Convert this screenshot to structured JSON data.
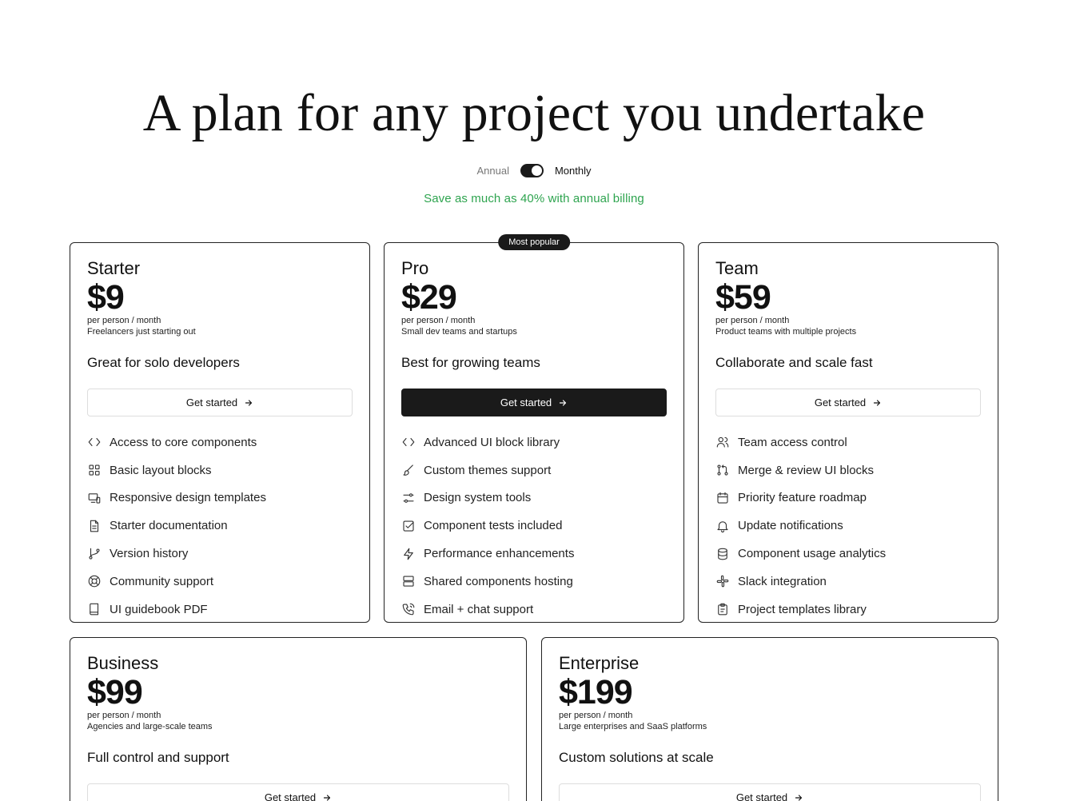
{
  "hero": {
    "title": "A plan for any project you undertake"
  },
  "billing": {
    "annual_label": "Annual",
    "monthly_label": "Monthly",
    "selected": "Monthly",
    "savings_text": "Save as much as 40% with annual billing",
    "savings_color": "#2ea44f"
  },
  "plans": [
    {
      "name": "Starter",
      "price": "$9",
      "period": "per person / month",
      "audience": "Freelancers just starting out",
      "tagline": "Great for solo developers",
      "cta": "Get started",
      "primary": false,
      "features": [
        {
          "icon": "code-icon",
          "label": "Access to core components"
        },
        {
          "icon": "grid-icon",
          "label": "Basic layout blocks"
        },
        {
          "icon": "devices-icon",
          "label": "Responsive design templates"
        },
        {
          "icon": "document-icon",
          "label": "Starter documentation"
        },
        {
          "icon": "git-branch-icon",
          "label": "Version history"
        },
        {
          "icon": "lifebuoy-icon",
          "label": "Community support"
        },
        {
          "icon": "book-icon",
          "label": "UI guidebook PDF"
        }
      ]
    },
    {
      "name": "Pro",
      "badge": "Most popular",
      "price": "$29",
      "period": "per person / month",
      "audience": "Small dev teams and startups",
      "tagline": "Best for growing teams",
      "cta": "Get started",
      "primary": true,
      "features": [
        {
          "icon": "code-icon",
          "label": "Advanced UI block library"
        },
        {
          "icon": "brush-icon",
          "label": "Custom themes support"
        },
        {
          "icon": "sliders-icon",
          "label": "Design system tools"
        },
        {
          "icon": "checkbox-icon",
          "label": "Component tests included"
        },
        {
          "icon": "zap-icon",
          "label": "Performance enhancements"
        },
        {
          "icon": "server-icon",
          "label": "Shared components hosting"
        },
        {
          "icon": "phone-icon",
          "label": "Email + chat support"
        }
      ]
    },
    {
      "name": "Team",
      "price": "$59",
      "period": "per person / month",
      "audience": "Product teams with multiple projects",
      "tagline": "Collaborate and scale fast",
      "cta": "Get started",
      "primary": false,
      "features": [
        {
          "icon": "users-icon",
          "label": "Team access control"
        },
        {
          "icon": "git-pull-request-icon",
          "label": "Merge & review UI blocks"
        },
        {
          "icon": "calendar-icon",
          "label": "Priority feature roadmap"
        },
        {
          "icon": "bell-icon",
          "label": "Update notifications"
        },
        {
          "icon": "database-icon",
          "label": "Component usage analytics"
        },
        {
          "icon": "slack-icon",
          "label": "Slack integration"
        },
        {
          "icon": "clipboard-icon",
          "label": "Project templates library"
        }
      ]
    },
    {
      "name": "Business",
      "price": "$99",
      "period": "per person / month",
      "audience": "Agencies and large-scale teams",
      "tagline": "Full control and support",
      "cta": "Get started",
      "primary": false,
      "features": []
    },
    {
      "name": "Enterprise",
      "price": "$199",
      "period": "per person / month",
      "audience": "Large enterprises and SaaS platforms",
      "tagline": "Custom solutions at scale",
      "cta": "Get started",
      "primary": false,
      "features": []
    }
  ]
}
